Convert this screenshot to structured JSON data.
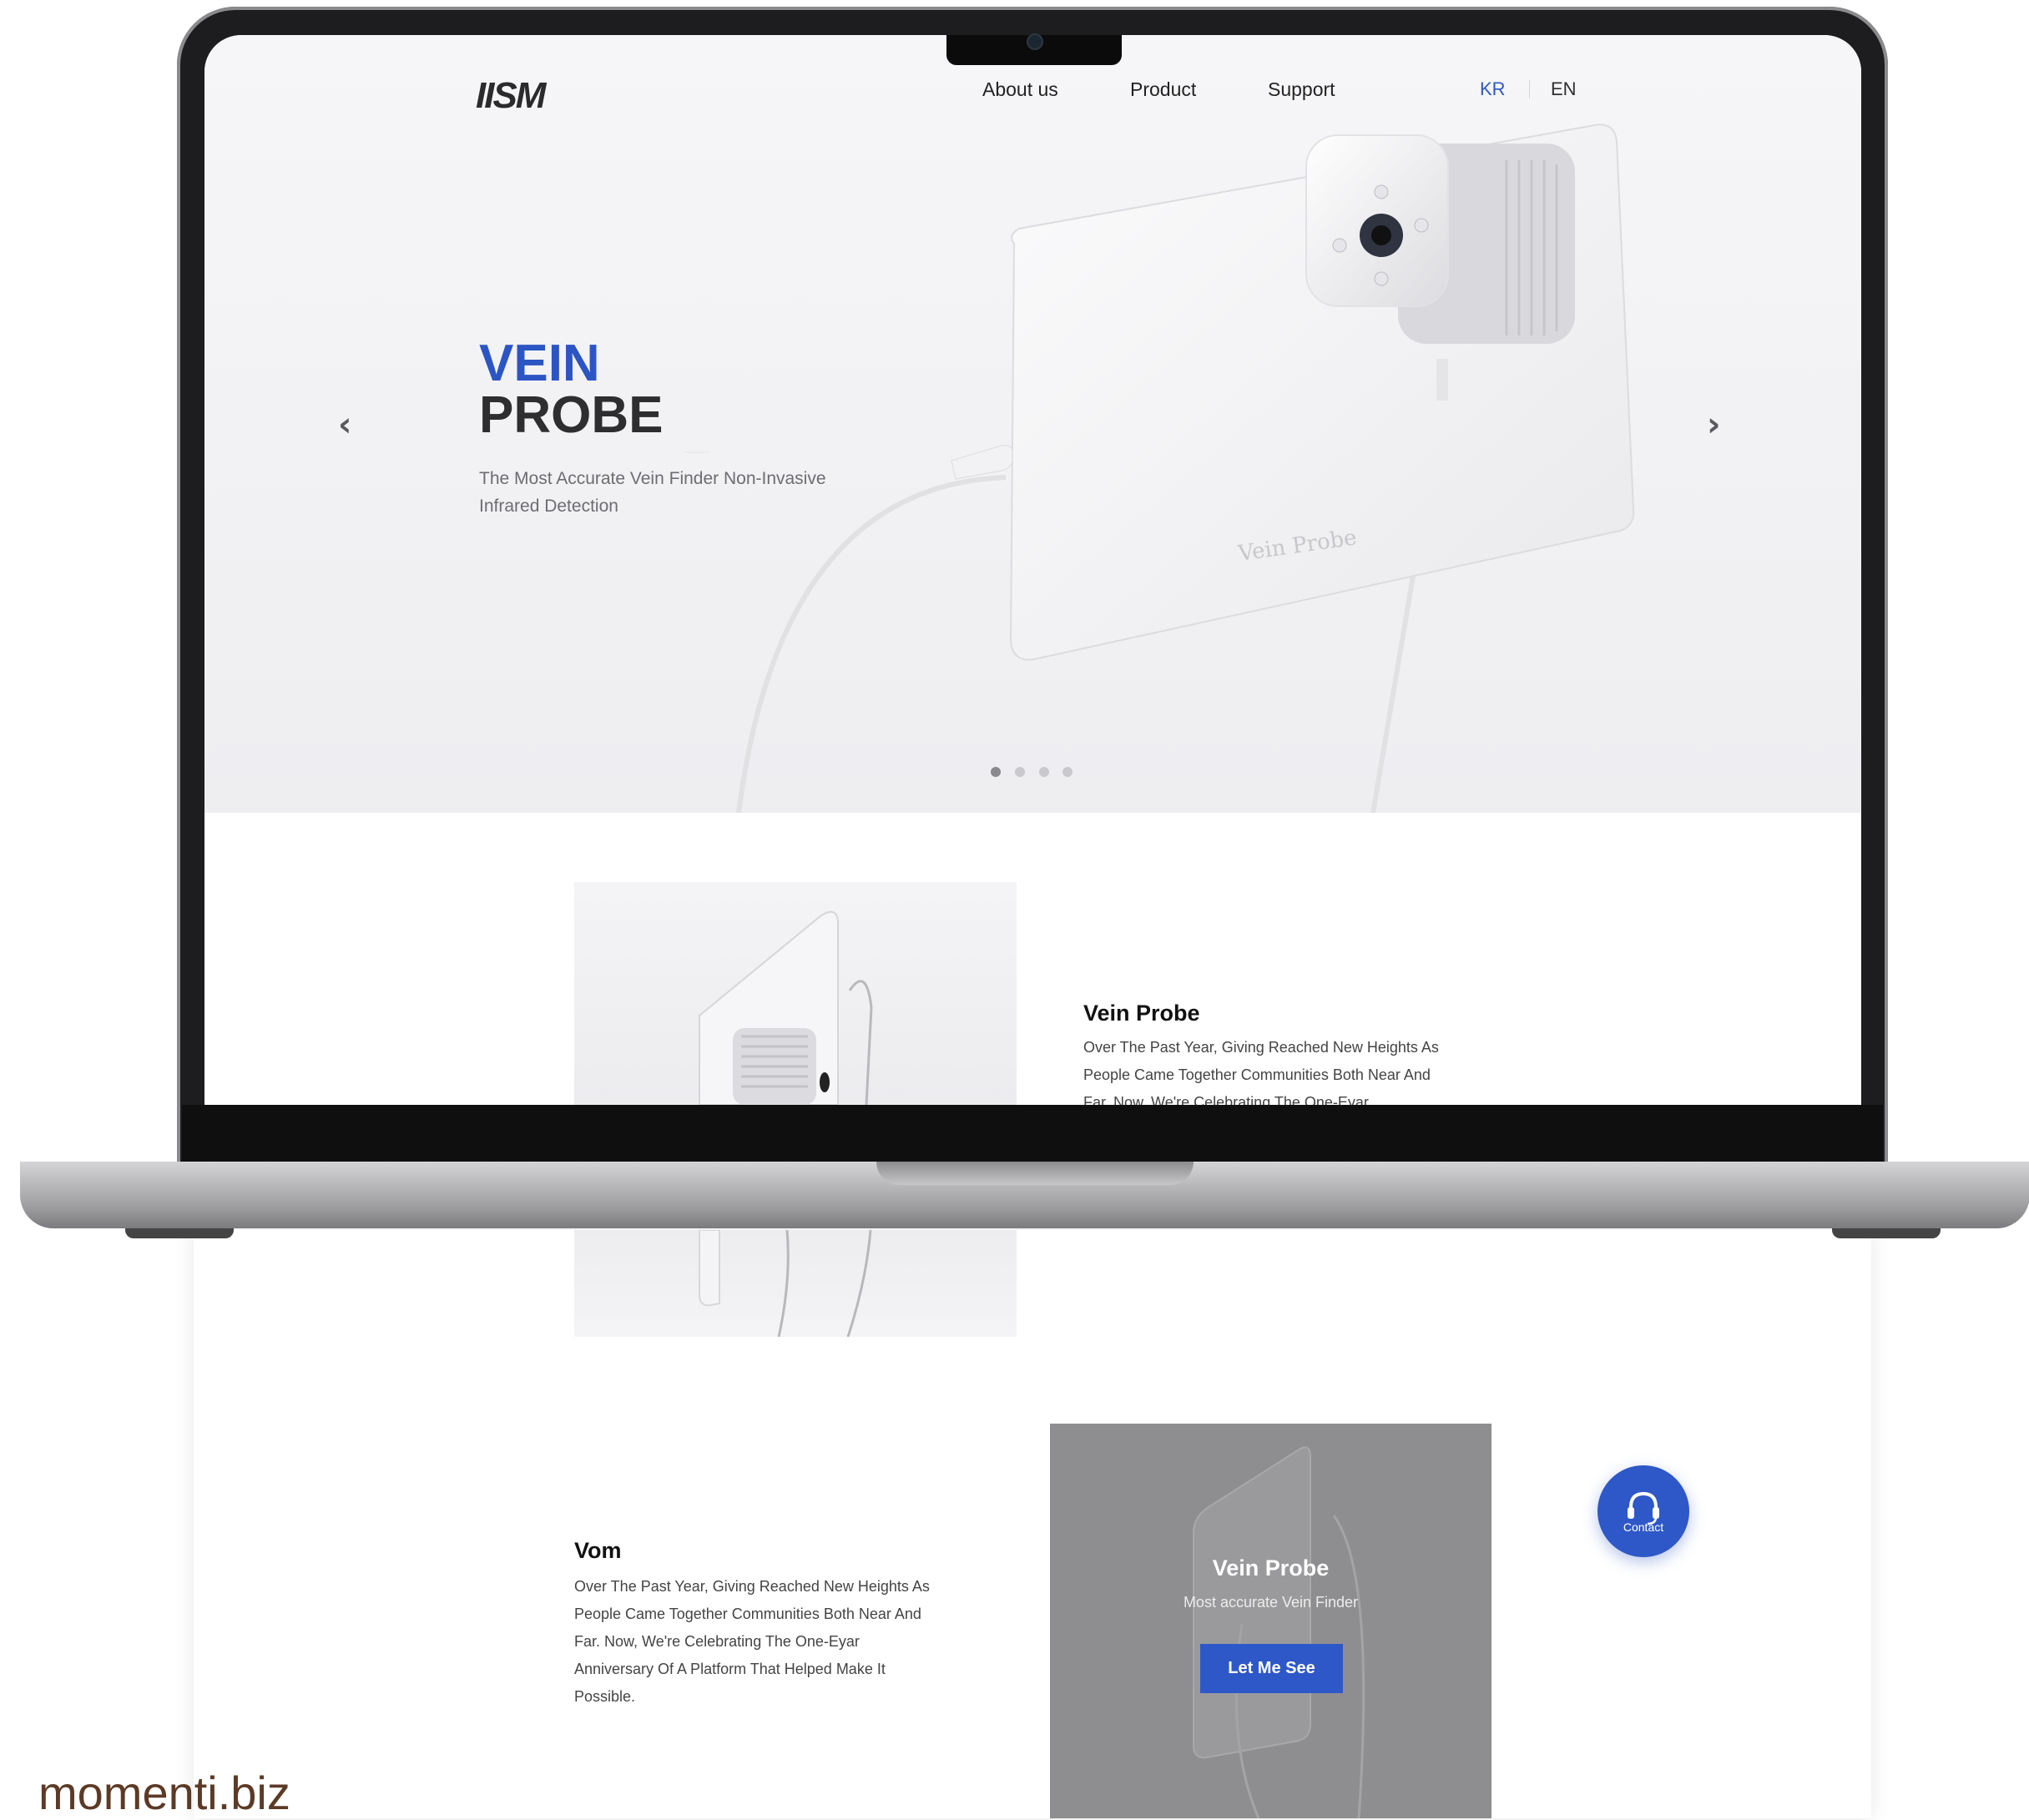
{
  "header": {
    "logo": "IISM",
    "nav": [
      "About us",
      "Product",
      "Support"
    ],
    "lang_active": "KR",
    "lang_other": "EN"
  },
  "hero": {
    "title_line1": "VEIN",
    "title_line2": "PROBE",
    "subtitle_line1": "The Most Accurate Vein Finder Non-Invasive",
    "subtitle_line2": "Infrared Detection",
    "device_label": "Vein Probe",
    "prev_icon": "chevron-left-icon",
    "next_icon": "chevron-right-icon",
    "slide_count": 4,
    "active_slide": 1
  },
  "colors": {
    "accent": "#2e58c7",
    "hero_title_accent": "#2c55c4",
    "text_dark": "#2e2e31",
    "brand_text": "#5c3a26"
  },
  "card1": {
    "title": "Vein Probe",
    "body_l1": "Over The Past Year, Giving Reached New Heights As",
    "body_l2": "People Came Together Communities Both Near And",
    "body_l3": "Far. Now, We're Celebrating The One-Eyar"
  },
  "card2": {
    "title": "Vom",
    "body_l1": "Over The Past Year, Giving Reached New Heights As",
    "body_l2": "People Came Together Communities Both Near And",
    "body_l3": "Far. Now, We're Celebrating The One-Eyar",
    "body_l4": "Anniversary Of A Platform That Helped Make It",
    "body_l5": "Possible."
  },
  "promo": {
    "title": "Vein Probe",
    "subtitle": "Most accurate Vein Finder",
    "button": "Let Me See"
  },
  "contact": {
    "label": "Contact",
    "icon": "headset-icon"
  },
  "watermark": "momenti.biz"
}
